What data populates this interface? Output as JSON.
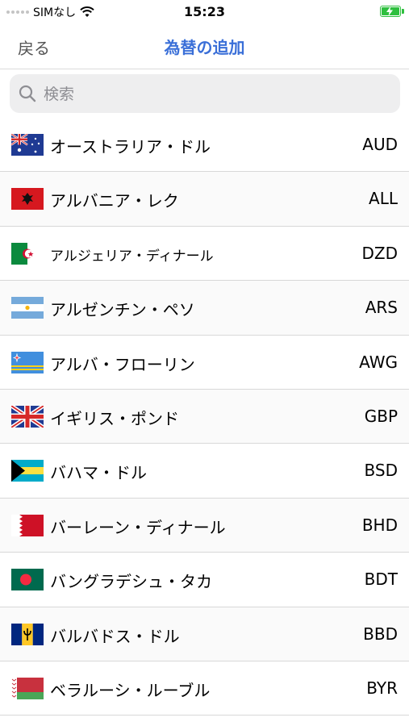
{
  "status_bar": {
    "carrier": "SIMなし",
    "time": "15:23",
    "battery_level": 1.0,
    "battery_color": "#2fbf3f"
  },
  "nav": {
    "back_label": "戻る",
    "title": "為替の追加",
    "title_color": "#3a6fd8"
  },
  "search": {
    "placeholder": "検索",
    "value": ""
  },
  "currencies": [
    {
      "name": "オーストラリア・ドル",
      "code": "AUD",
      "flag_icon": "australia-flag-icon"
    },
    {
      "name": "アルバニア・レク",
      "code": "ALL",
      "flag_icon": "albania-flag-icon"
    },
    {
      "name": "アルジェリア・ディナール",
      "code": "DZD",
      "flag_icon": "algeria-flag-icon"
    },
    {
      "name": "アルゼンチン・ペソ",
      "code": "ARS",
      "flag_icon": "argentina-flag-icon"
    },
    {
      "name": "アルバ・フローリン",
      "code": "AWG",
      "flag_icon": "aruba-flag-icon"
    },
    {
      "name": "イギリス・ポンド",
      "code": "GBP",
      "flag_icon": "uk-flag-icon"
    },
    {
      "name": "バハマ・ドル",
      "code": "BSD",
      "flag_icon": "bahamas-flag-icon"
    },
    {
      "name": "バーレーン・ディナール",
      "code": "BHD",
      "flag_icon": "bahrain-flag-icon"
    },
    {
      "name": "バングラデシュ・タカ",
      "code": "BDT",
      "flag_icon": "bangladesh-flag-icon"
    },
    {
      "name": "バルバドス・ドル",
      "code": "BBD",
      "flag_icon": "barbados-flag-icon"
    },
    {
      "name": "ベラルーシ・ルーブル",
      "code": "BYR",
      "flag_icon": "belarus-flag-icon"
    }
  ]
}
